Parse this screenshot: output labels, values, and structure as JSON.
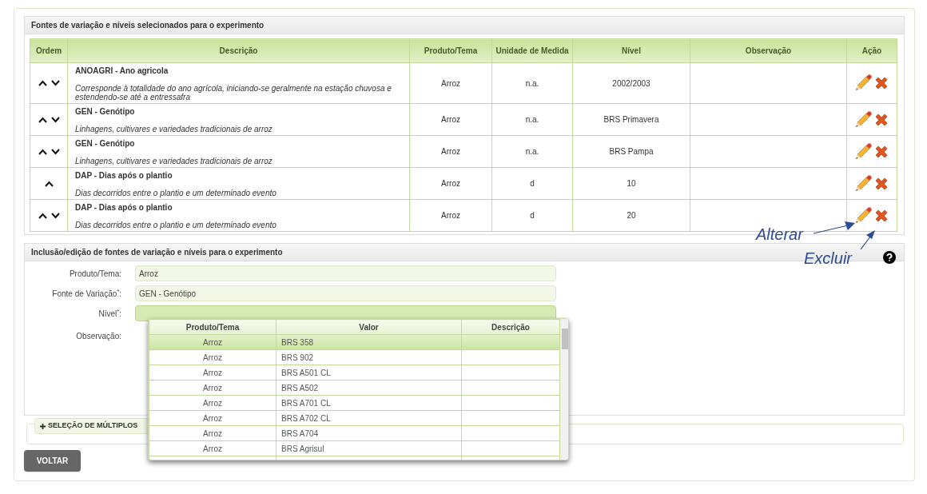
{
  "selected_section": {
    "title": "Fontes de variação e níveis selecionados para o experimento",
    "columns": [
      "Ordem",
      "Descrição",
      "Produto/Tema",
      "Unidade de Medida",
      "Nível",
      "Observação",
      "Ação"
    ],
    "rows": [
      {
        "can_move_up": true,
        "can_move_down": true,
        "name": "ANOAGRI - Ano agricola",
        "description": "Corresponde à totalidade do ano agrícola, iniciando-se geralmente na estação chuvosa e estendendo-se até a entressafra",
        "product": "Arroz",
        "unit": "n.a.",
        "level_value": "2002/2003"
      },
      {
        "can_move_up": true,
        "can_move_down": true,
        "name": "GEN - Genótipo",
        "description": "Linhagens, cultivares e variedades tradicionais de arroz",
        "product": "Arroz",
        "unit": "n.a.",
        "level_value": "BRS Primavera"
      },
      {
        "can_move_up": true,
        "can_move_down": true,
        "name": "GEN - Genótipo",
        "description": "Linhagens, cultivares e variedades tradicionais de arroz",
        "product": "Arroz",
        "unit": "n.a.",
        "level_value": "BRS Pampa"
      },
      {
        "can_move_up": true,
        "can_move_down": false,
        "name": "DAP - Dias após o plantio",
        "description": "Dias decorridos entre o plantio e um determinado evento",
        "product": "Arroz",
        "unit": "d",
        "level_value": "10"
      },
      {
        "can_move_up": true,
        "can_move_down": true,
        "name": "DAP - Dias após o plantio",
        "description": "Dias decorridos entre o plantio e um determinado evento",
        "product": "Arroz",
        "unit": "d",
        "level_value": "20"
      }
    ]
  },
  "annotations": [
    "Alterar",
    "Excluir"
  ],
  "edit_section": {
    "title": "Inclusão/edição de fontes de variação e níveis para o experimento",
    "fields": [
      {
        "label": "Produto/Tema:",
        "value": "Arroz",
        "focused": false
      },
      {
        "label": "Fonte de Variação$^{*}$:",
        "value": "GEN - Genótipo",
        "focused": false
      },
      {
        "label": "Nível$^{*}$:",
        "focused": true
      }
    ],
    "observation_label": "Observação:",
    "dropdown": {
      "columns": [
        "Produto/Tema",
        "Valor",
        "Descrição"
      ],
      "rows": [
        {
          "product": "Arroz",
          "value": "BRS 358",
          "selected": true
        },
        {
          "product": "Arroz",
          "value": "BRS 902",
          "selected": false
        },
        {
          "product": "Arroz",
          "value": "BRS A501 CL",
          "selected": false
        },
        {
          "product": "Arroz",
          "value": "BRS A502",
          "selected": false
        },
        {
          "product": "Arroz",
          "value": "BRS A701 CL",
          "selected": false
        },
        {
          "product": "Arroz",
          "value": "BRS A702 CL",
          "selected": false
        },
        {
          "product": "Arroz",
          "value": "BRS A704",
          "selected": false
        },
        {
          "product": "Arroz",
          "value": "BRS Agrisul",
          "selected": false
        }
      ]
    }
  },
  "multi_select": {
    "label": "SELEÇÃO DE MÚLTIPLOS"
  },
  "back_button": "VOLTAR"
}
